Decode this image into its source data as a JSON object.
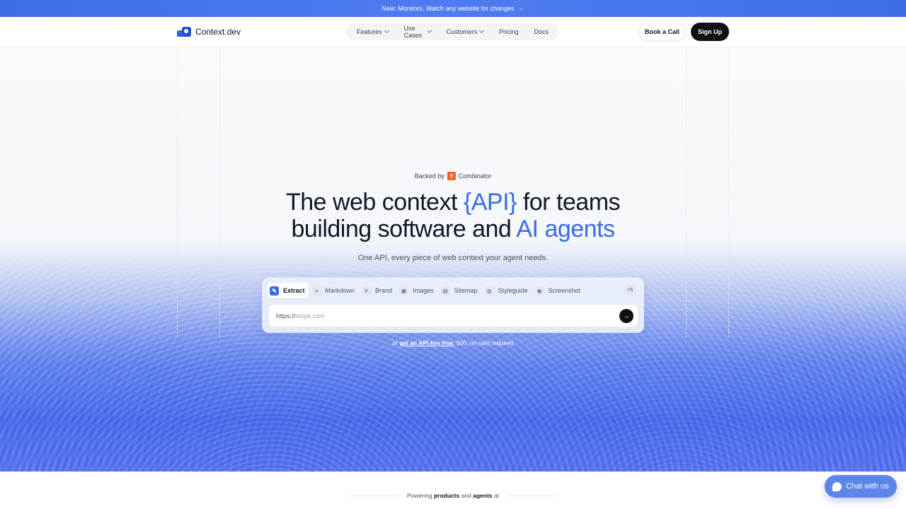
{
  "banner": {
    "text": "New: Monitors. Watch any website for changes",
    "arrow": "→"
  },
  "brand": {
    "name": "Context.dev"
  },
  "nav": {
    "items": [
      {
        "label": "Features",
        "dropdown": true
      },
      {
        "label": "Use Cases",
        "dropdown": true
      },
      {
        "label": "Customers",
        "dropdown": true
      },
      {
        "label": "Pricing",
        "dropdown": false
      },
      {
        "label": "Docs",
        "dropdown": false
      }
    ],
    "book_call": "Book a Call",
    "sign_up": "Sign Up"
  },
  "hero": {
    "backed_prefix": "Backed by",
    "yc_logo": "Y",
    "backed_suffix": "Combinator",
    "headline": {
      "part1": "The web context ",
      "accent1": "{API}",
      "part2": " for teams",
      "part3": "building software and ",
      "accent2": "AI agents"
    },
    "subtitle": "One API, every piece of web context your agent needs."
  },
  "tool": {
    "tabs": [
      {
        "label": "Extract",
        "icon": "pen-icon",
        "active": true
      },
      {
        "label": "Markdown",
        "icon": "markdown-icon",
        "active": false
      },
      {
        "label": "Brand",
        "icon": "brand-icon",
        "active": false
      },
      {
        "label": "Images",
        "icon": "image-icon",
        "active": false
      },
      {
        "label": "Sitemap",
        "icon": "sitemap-icon",
        "active": false
      },
      {
        "label": "Styleguide",
        "icon": "palette-icon",
        "active": false
      },
      {
        "label": "Screenshot",
        "icon": "camera-icon",
        "active": false
      }
    ],
    "more": "+5",
    "url_prefix": "https://",
    "url_placeholder": "stripe.com"
  },
  "apikey": {
    "prefix": "or ",
    "link": "get an API key free.",
    "suffix": " 500, no card required"
  },
  "powering": {
    "prefix": "Powering ",
    "products": "products",
    "and": " and ",
    "agents": "agents",
    "suffix": " at"
  },
  "chat": {
    "label": "Chat with us"
  },
  "colors": {
    "accent": "#3a6be8",
    "banner": "#3d6ee8",
    "yc": "#f26522",
    "dark_button": "#111111"
  }
}
